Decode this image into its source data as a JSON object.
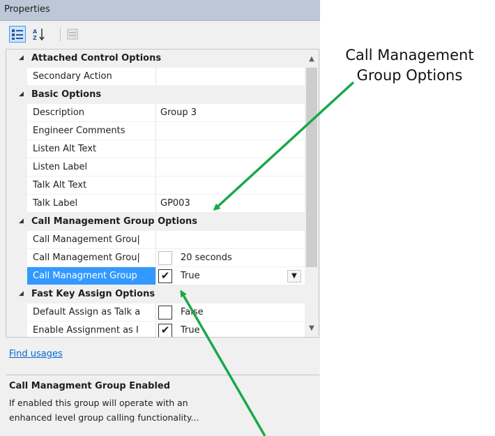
{
  "panel": {
    "title": "Properties",
    "toolbar": {
      "categorized_icon": "categorized-icon",
      "alphabetical_icon": "sort-az-icon",
      "property_pages_icon": "property-pages-icon"
    }
  },
  "categories": [
    {
      "label": "Attached Control Options",
      "expanded": true
    },
    {
      "label": "Basic Options",
      "expanded": true
    },
    {
      "label": "Call Management Group Options",
      "expanded": true
    },
    {
      "label": "Fast Key Assign Options",
      "expanded": true
    }
  ],
  "properties": {
    "secondary_action": {
      "name": "Secondary Action",
      "value": ""
    },
    "description": {
      "name": "Description",
      "value": "Group 3"
    },
    "engineer_comments": {
      "name": "Engineer Comments",
      "value": ""
    },
    "listen_alt_text": {
      "name": "Listen Alt Text",
      "value": ""
    },
    "listen_label": {
      "name": "Listen Label",
      "value": ""
    },
    "talk_alt_text": {
      "name": "Talk Alt Text",
      "value": ""
    },
    "talk_label": {
      "name": "Talk Label",
      "value": "GP003"
    },
    "cmg_1": {
      "name": "Call Management Grou|",
      "value": ""
    },
    "cmg_2": {
      "name": "Call Management Grou|",
      "value": "20 seconds",
      "checked": false
    },
    "cmg_enabled": {
      "name": "Call Managment Group",
      "value": "True",
      "checked": true,
      "selected": true
    },
    "default_assign": {
      "name": "Default Assign as Talk a",
      "value": "False",
      "checked": false
    },
    "enable_assign": {
      "name": "Enable Assignment as I",
      "value": "True",
      "checked": true
    }
  },
  "links": {
    "find_usages": "Find usages"
  },
  "description": {
    "title": "Call Managment Group Enabled",
    "line1": "If enabled this group will operate with an",
    "line2": "enhanced level group calling functionality..."
  },
  "annotation": {
    "line1": "Call Management",
    "line2": "Group Options",
    "arrow_color": "#1aa84a"
  },
  "colors": {
    "selection": "#3399ff",
    "titlebar": "#bcc7d8",
    "link": "#0066cc"
  }
}
